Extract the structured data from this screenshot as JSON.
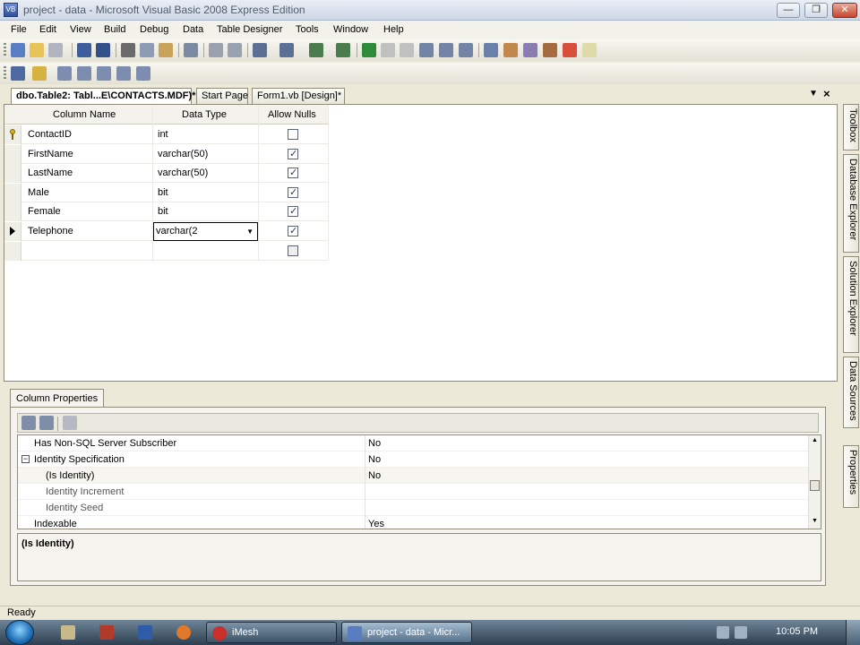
{
  "window": {
    "title": "project - data - Microsoft Visual Basic 2008 Express Edition",
    "app_icon": "VB"
  },
  "menu": [
    "File",
    "Edit",
    "View",
    "Build",
    "Debug",
    "Data",
    "Table Designer",
    "Tools",
    "Window",
    "Help"
  ],
  "doc_tabs": [
    {
      "label": "dbo.Table2: Tabl...E\\CONTACTS.MDF)*",
      "active": true
    },
    {
      "label": "Start Page",
      "active": false
    },
    {
      "label": "Form1.vb [Design]*",
      "active": false
    }
  ],
  "designer": {
    "headers": {
      "name": "Column Name",
      "type": "Data Type",
      "nulls": "Allow Nulls"
    },
    "rows": [
      {
        "name": "ContactID",
        "type": "int",
        "allow_nulls": false,
        "primary_key": true
      },
      {
        "name": "FirstName",
        "type": "varchar(50)",
        "allow_nulls": true
      },
      {
        "name": "LastName",
        "type": "varchar(50)",
        "allow_nulls": true
      },
      {
        "name": "Male",
        "type": "bit",
        "allow_nulls": true
      },
      {
        "name": "Female",
        "type": "bit",
        "allow_nulls": true
      },
      {
        "name": "Telephone",
        "type": "varchar(2",
        "allow_nulls": true,
        "current": true,
        "editing": true
      },
      {
        "name": "",
        "type": "",
        "allow_nulls": false
      }
    ]
  },
  "column_properties": {
    "tab_label": "Column Properties",
    "properties": [
      {
        "name": "Has Non-SQL Server Subscriber",
        "value": "No",
        "level": 1
      },
      {
        "name": "Identity Specification",
        "value": "No",
        "level": 0,
        "expandable": true,
        "expanded": true
      },
      {
        "name": "(Is Identity)",
        "value": "No",
        "level": 2,
        "highlight": true
      },
      {
        "name": "Identity Increment",
        "value": "",
        "level": 2
      },
      {
        "name": "Identity Seed",
        "value": "",
        "level": 2
      },
      {
        "name": "Indexable",
        "value": "Yes",
        "level": 1
      }
    ],
    "description_title": "(Is Identity)"
  },
  "right_dock": [
    "Toolbox",
    "Database Explorer",
    "Solution Explorer",
    "Data Sources",
    "Properties"
  ],
  "status": "Ready",
  "taskbar": {
    "items": [
      {
        "label": "iMesh",
        "active": false
      },
      {
        "label": "project - data - Micr...",
        "active": true
      }
    ],
    "clock": "10:05 PM"
  },
  "colors": {
    "taskbar": "#2d3f50",
    "accent": "#1f6fb5",
    "background": "#ece9d8"
  }
}
